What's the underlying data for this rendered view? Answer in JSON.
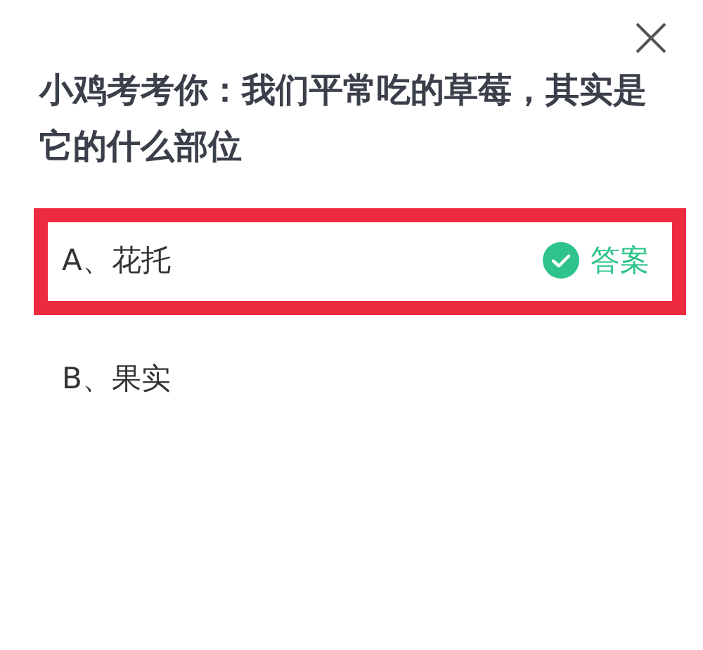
{
  "question": "小鸡考考你：我们平常吃的草莓，其实是它的什么部位",
  "options": [
    {
      "label": "A、花托",
      "correct": true,
      "highlighted": true,
      "badge": "答案"
    },
    {
      "label": "B、果实",
      "correct": false,
      "highlighted": false
    }
  ]
}
